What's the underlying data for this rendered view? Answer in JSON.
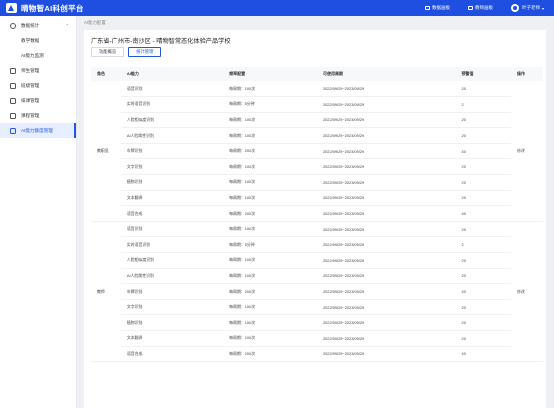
{
  "topbar": {
    "brand": "晴物智AI科创平台",
    "link1": "数据画板",
    "link2": "教师画板",
    "user": "叶子老师"
  },
  "sidebar": {
    "items": [
      {
        "label": "数据统计",
        "icon": "chart-icon"
      },
      {
        "label": "教学数据"
      },
      {
        "label": "AI能力监测"
      },
      {
        "label": "师生管理",
        "icon": "user-icon"
      },
      {
        "label": "班级管理",
        "icon": "class-icon"
      },
      {
        "label": "排课管理",
        "icon": "schedule-icon"
      },
      {
        "label": "课程管理",
        "icon": "course-icon"
      },
      {
        "label": "AI能力额度管理",
        "icon": "settings-icon"
      }
    ]
  },
  "breadcrumb": "AI能力配置",
  "page": {
    "title": "广东省-广州市-南沙区 - 晴物智常态化体验产品学校",
    "tabs": [
      "功能概览",
      "统计管理"
    ]
  },
  "table": {
    "headers": [
      "角色",
      "AI能力",
      "频率配置",
      "可使用周期",
      "预警值",
      "操作"
    ],
    "groups": [
      {
        "role": "教职员",
        "op": "修改",
        "rows": [
          [
            "语音识别",
            "每周期：100次",
            "2022/09/29~2023/09/29",
            "20"
          ],
          [
            "实时语音识别",
            "每周期：5分钟",
            "2022/09/29~2023/09/29",
            "2"
          ],
          [
            "人脸相似度识别",
            "每周期：100次",
            "2022/09/29~2023/09/29",
            "20"
          ],
          [
            "AI人脸属性识别",
            "每周期：100次",
            "2022/09/29~2023/09/29",
            "20"
          ],
          [
            "车牌识别",
            "每周期：200次",
            "2022/09/29~2023/09/29",
            "40"
          ],
          [
            "文字识别",
            "每周期：100次",
            "2022/09/29~2023/09/29",
            "20"
          ],
          [
            "植物识别",
            "每周期：100次",
            "2022/09/29~2023/09/29",
            "20"
          ],
          [
            "文本翻译",
            "每周期：100次",
            "2022/09/29~2023/09/29",
            "20"
          ],
          [
            "语音合成",
            "每周期：200次",
            "2022/09/29~2023/09/29",
            "40"
          ]
        ]
      },
      {
        "role": "教师",
        "op": "修改",
        "rows": [
          [
            "语音识别",
            "每周期：100次",
            "2022/09/29~2023/09/29",
            "20"
          ],
          [
            "实时语音识别",
            "每周期：5分钟",
            "2022/09/29~2023/09/29",
            "2"
          ],
          [
            "人脸相似度识别",
            "每周期：100次",
            "2022/09/29~2023/09/29",
            "20"
          ],
          [
            "AI人脸属性识别",
            "每周期：100次",
            "2022/09/29~2023/09/29",
            "20"
          ],
          [
            "车牌识别",
            "每周期：200次",
            "2022/09/29~2023/09/29",
            "40"
          ],
          [
            "文字识别",
            "每周期：100次",
            "2022/09/29~2023/09/29",
            "20"
          ],
          [
            "植物识别",
            "每周期：100次",
            "2022/09/29~2023/09/29",
            "20"
          ],
          [
            "文本翻译",
            "每周期：100次",
            "2022/09/29~2023/09/29",
            "20"
          ],
          [
            "语音合成",
            "每周期：200次",
            "2022/09/29~2023/09/29",
            "40"
          ]
        ]
      }
    ]
  },
  "colors": {
    "brand": "#1f4fe0",
    "active": "#2456e6"
  }
}
